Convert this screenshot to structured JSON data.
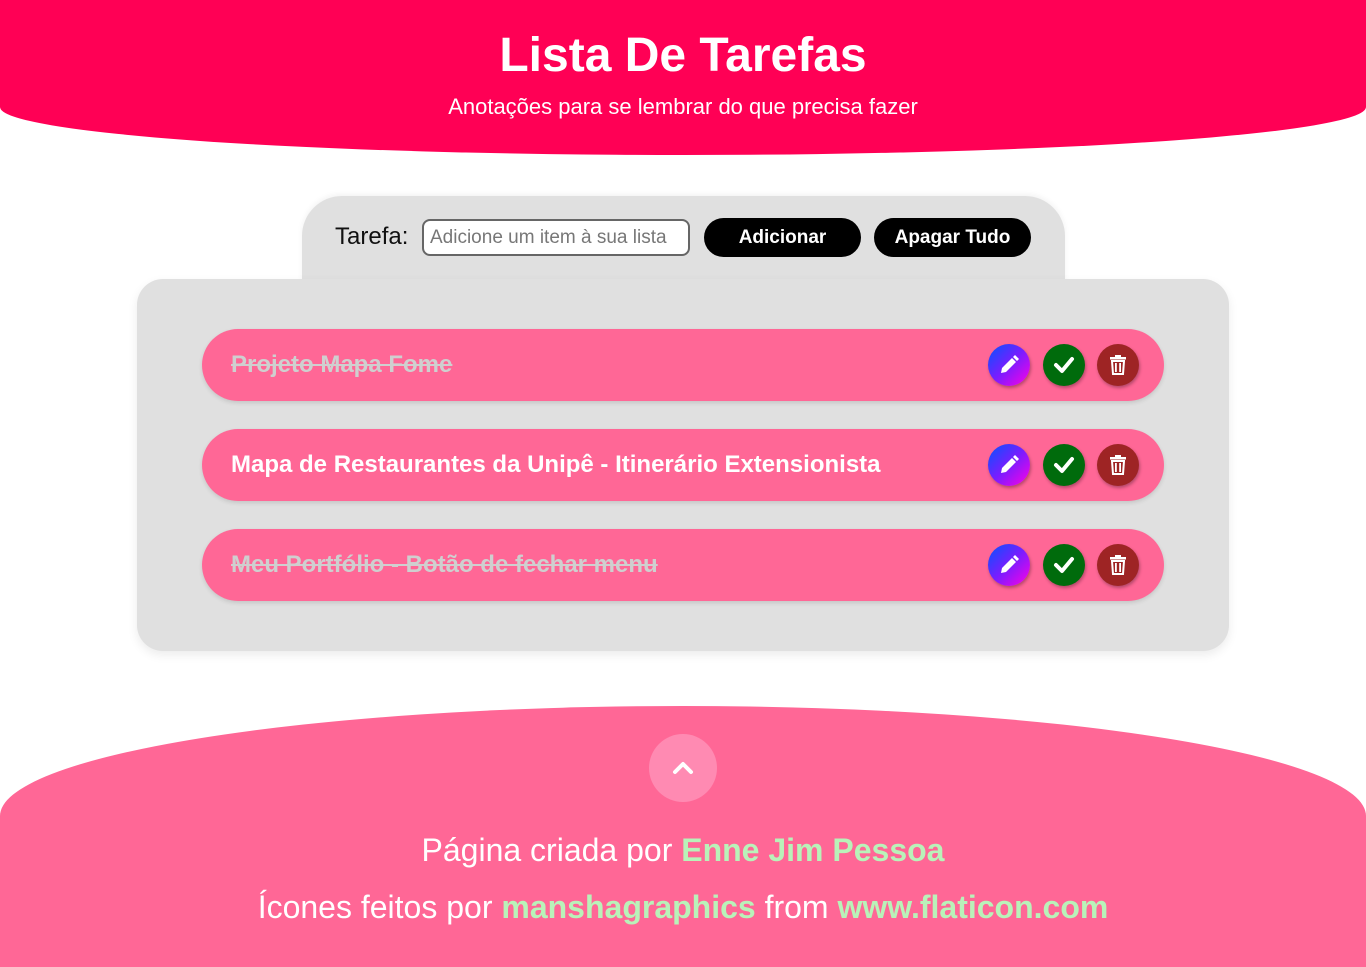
{
  "header": {
    "title": "Lista De Tarefas",
    "subtitle": "Anotações para se lembrar do que precisa fazer"
  },
  "form": {
    "label": "Tarefa:",
    "input_placeholder": "Adicione um item à sua lista",
    "input_value": "",
    "add_label": "Adicionar",
    "clear_label": "Apagar Tudo"
  },
  "tasks": [
    {
      "text": "Projeto Mapa Fome",
      "done": true
    },
    {
      "text": "Mapa de Restaurantes da Unipê - Itinerário Extensionista",
      "done": false
    },
    {
      "text": "Meu Portfólio - Botão de fechar menu",
      "done": true
    }
  ],
  "task_icons": [
    "pencil-icon",
    "check-icon",
    "trash-icon"
  ],
  "footer": {
    "credit_prefix": "Página criada por ",
    "author": "Enne Jim Pessoa",
    "icons_prefix": "Ícones feitos por ",
    "icons_author": "manshagraphics",
    "from_text": " from ",
    "site": "www.flaticon.com",
    "back_to_top_icon": "chevron-up-icon"
  },
  "colors": {
    "header_bg": "#ff0055",
    "item_bg": "#ff6796",
    "footer_bg": "#ff6796",
    "link_green": "#b9f2b9",
    "check_green": "#006b0c",
    "delete_red": "#9e2424",
    "panel_gray": "#e0e0e0"
  }
}
